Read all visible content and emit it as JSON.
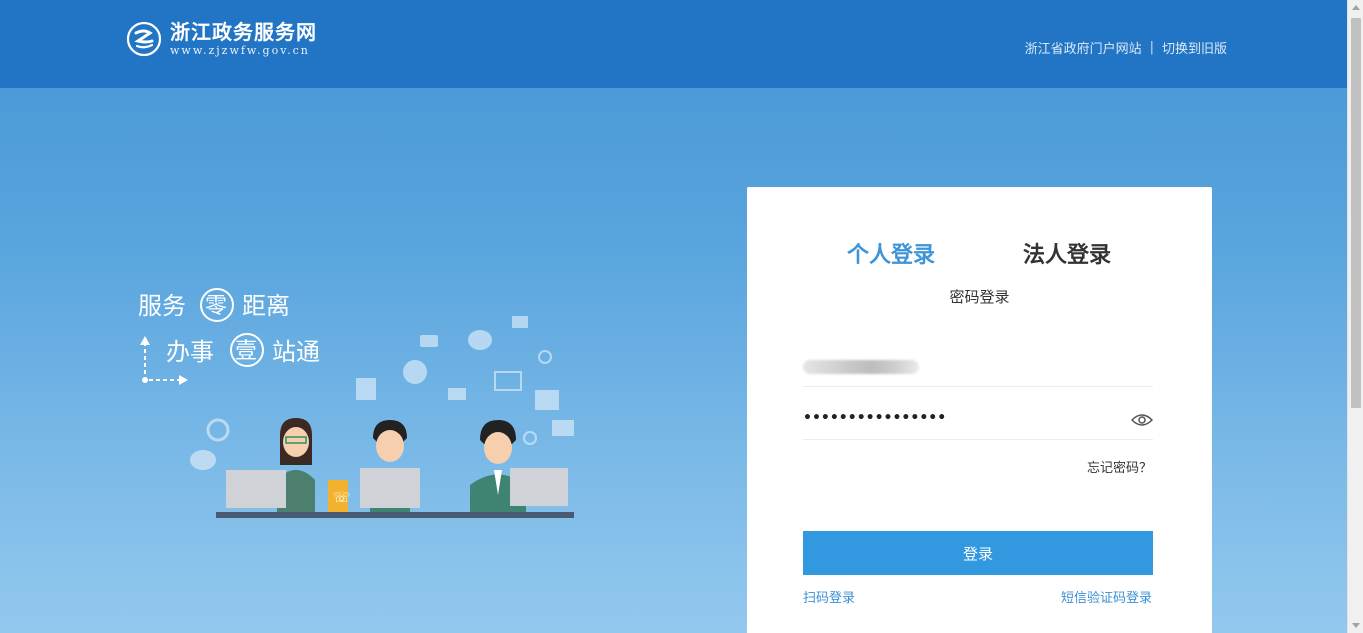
{
  "header": {
    "logo_title": "浙江政务服务网",
    "logo_url_text": "www.zjzwfw.gov.cn",
    "link_portal": "浙江省政府门户网站",
    "separator": "|",
    "link_old_version": "切换到旧版"
  },
  "slogan": {
    "line1_a": "服务",
    "line1_circle": "零",
    "line1_b": "距离",
    "line2_a": "办事",
    "line2_circle": "壹",
    "line2_b": "站通"
  },
  "login": {
    "tab_personal": "个人登录",
    "tab_legal": "法人登录",
    "mode_label": "密码登录",
    "password_masked": "••••••••••••••••",
    "forgot_password": "忘记密码？",
    "submit_label": "登录",
    "qr_login": "扫码登录",
    "sms_login": "短信验证码登录"
  },
  "colors": {
    "header_bg": "#2275c4",
    "accent": "#3299e1",
    "tab_active": "#3d94d8"
  },
  "icons": [
    "logo-icon",
    "eye-icon",
    "arrow-up-icon",
    "arrow-down-icon"
  ]
}
